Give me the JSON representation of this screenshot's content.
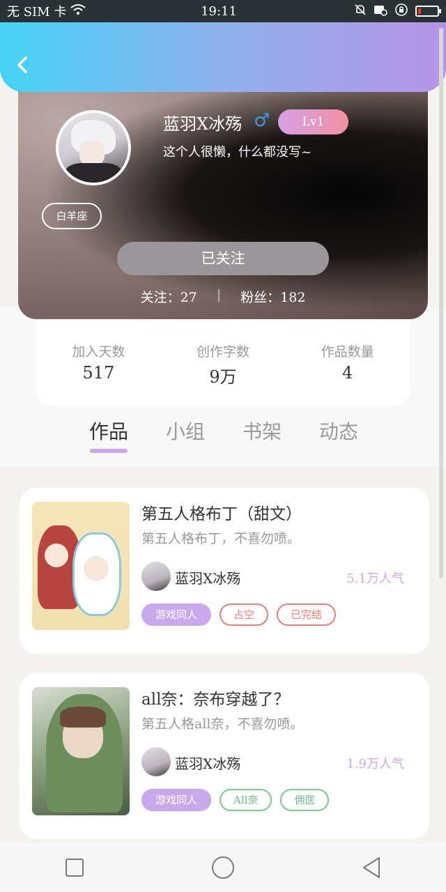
{
  "status_bar": {
    "carrier": "无 SIM 卡",
    "time": "19:11",
    "icons": [
      "wifi-icon",
      "bell-mute-icon",
      "no-sim-icon",
      "lock-rotate-icon",
      "battery-icon"
    ]
  },
  "header": {
    "back_icon": "chevron-left-icon"
  },
  "profile": {
    "username": "蓝羽X冰殇",
    "gender_icon": "♂",
    "level": "Lv1",
    "bio": "这个人很懒，什么都没写~",
    "zodiac": "白羊座",
    "follow_button": "已关注",
    "following_label": "关注：27",
    "followers_label": "粉丝：182",
    "divider": "|"
  },
  "stats": [
    {
      "label": "加入天数",
      "value": "517"
    },
    {
      "label": "创作字数",
      "value": "9万"
    },
    {
      "label": "作品数量",
      "value": "4"
    }
  ],
  "tabs": [
    {
      "label": "作品",
      "active": true
    },
    {
      "label": "小组",
      "active": false
    },
    {
      "label": "书架",
      "active": false
    },
    {
      "label": "动态",
      "active": false
    }
  ],
  "works": [
    {
      "title": "第五人格布丁（甜文）",
      "description": "第五人格布丁，不喜勿喷。",
      "author": "蓝羽X冰殇",
      "popularity": "5.1万人气",
      "tags": [
        {
          "label": "游戏同人",
          "style": "solid"
        },
        {
          "label": "占空",
          "style": "red"
        },
        {
          "label": "已完结",
          "style": "red"
        }
      ]
    },
    {
      "title": "all奈：奈布穿越了？",
      "description": "第五人格all奈，不喜勿喷。",
      "author": "蓝羽X冰殇",
      "popularity": "1.9万人气",
      "tags": [
        {
          "label": "游戏同人",
          "style": "solid"
        },
        {
          "label": "All奈",
          "style": "green"
        },
        {
          "label": "佣医",
          "style": "green"
        }
      ]
    }
  ],
  "colors": {
    "accent_purple": "#c9a8ec",
    "tag_red": "#e77d7a",
    "tag_green": "#7ec592",
    "header_gradient_start": "#45d3f5",
    "header_gradient_end": "#b794e6"
  }
}
